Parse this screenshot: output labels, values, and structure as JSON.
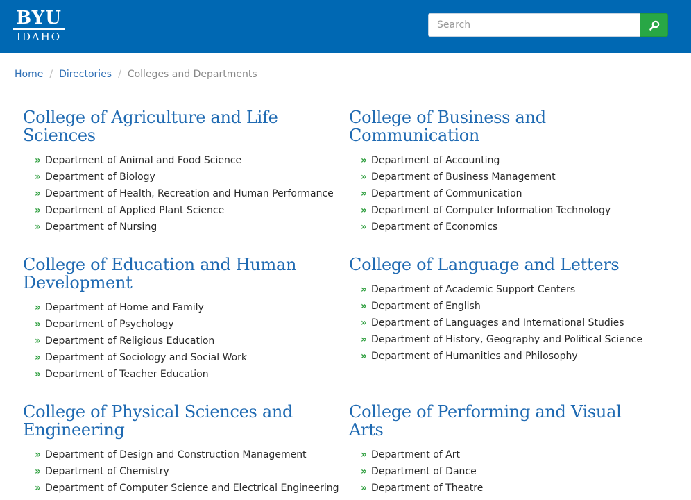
{
  "header": {
    "logo_top": "BYU",
    "logo_bottom": "IDAHO",
    "search": {
      "placeholder": "Search",
      "value": ""
    },
    "brand_color": "#0068b3",
    "search_button_color": "#28a745"
  },
  "breadcrumb": {
    "items": [
      "Home",
      "Directories"
    ],
    "current": "Colleges and Departments"
  },
  "colleges": [
    {
      "title": "College of Agriculture and Life Sciences",
      "departments": [
        "Department of Animal and Food Science",
        "Department of Biology",
        "Department of Health, Recreation and Human Performance",
        "Department of Applied Plant Science",
        "Department of Nursing"
      ]
    },
    {
      "title": "College of Business and Communication",
      "departments": [
        "Department of Accounting",
        "Department of Business Management",
        "Department of Communication",
        "Department of Computer Information Technology",
        "Department of Economics"
      ]
    },
    {
      "title": "College of Education and Human Development",
      "departments": [
        "Department of Home and Family",
        "Department of Psychology",
        "Department of Religious Education",
        "Department of Sociology and Social Work",
        "Department of Teacher Education"
      ]
    },
    {
      "title": "College of Language and Letters",
      "departments": [
        "Department of Academic Support Centers",
        "Department of English",
        "Department of Languages and International Studies",
        "Department of History, Geography and Political Science",
        "Department of Humanities and Philosophy"
      ]
    },
    {
      "title": "College of Physical Sciences and Engineering",
      "departments": [
        "Department of Design and Construction Management",
        "Department of Chemistry",
        "Department of Computer Science and Electrical Engineering"
      ]
    },
    {
      "title": "College of Performing and Visual Arts",
      "departments": [
        "Department of Art",
        "Department of Dance",
        "Department of Theatre"
      ]
    }
  ]
}
